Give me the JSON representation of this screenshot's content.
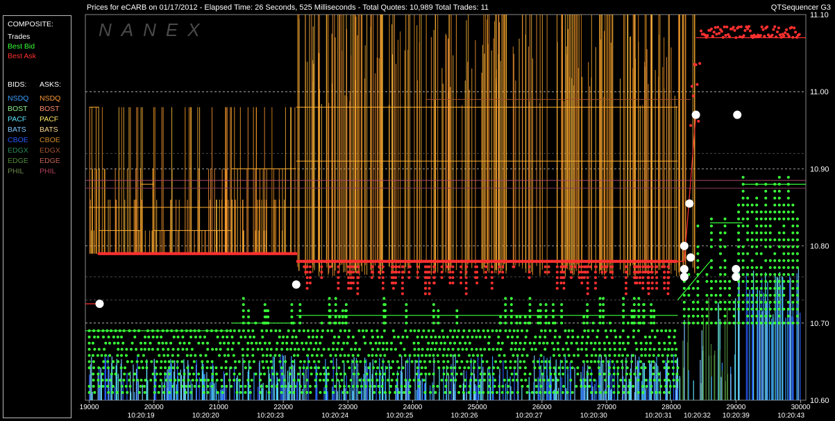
{
  "header": {
    "title": "Prices for  eCARB  on  01/17/2012  -  Elapsed Time: 26 Seconds, 525 Milliseconds  -  Total Quotes: 10,989  Total Trades: 11",
    "right_label": "QTSequencer G3"
  },
  "watermark": "NANEX",
  "legend": {
    "composite_title": "COMPOSITE:",
    "composite_items": [
      {
        "label": "Trades",
        "color": "#ffffff"
      },
      {
        "label": "Best Bid",
        "color": "#39ff39"
      },
      {
        "label": "Best Ask",
        "color": "#ff3030"
      }
    ],
    "bids_title": "BIDS:",
    "asks_title": "ASKS:",
    "exchanges": [
      {
        "bid": "NSDQ",
        "ask": "NSDQ",
        "bid_color": "#3aa0ff",
        "ask_color": "#ff9a3a"
      },
      {
        "bid": "BOST",
        "ask": "BOST",
        "bid_color": "#8ff08f",
        "ask_color": "#ff8c6a"
      },
      {
        "bid": "PACF",
        "ask": "PACF",
        "bid_color": "#5ee6ff",
        "ask_color": "#ffe866"
      },
      {
        "bid": "BATS",
        "ask": "BATS",
        "bid_color": "#7ec8ff",
        "ask_color": "#ffd890"
      },
      {
        "bid": "CBOE",
        "ask": "CBOE",
        "bid_color": "#2a5cff",
        "ask_color": "#d08a2a"
      },
      {
        "bid": "EDGX",
        "ask": "EDGX",
        "bid_color": "#2a8a5a",
        "ask_color": "#a0522d"
      },
      {
        "bid": "EDGE",
        "ask": "EDGE",
        "bid_color": "#4f8a3a",
        "ask_color": "#c06050"
      },
      {
        "bid": "PHIL",
        "ask": "PHIL",
        "bid_color": "#6a8a4a",
        "ask_color": "#b0405a"
      }
    ]
  },
  "chart_data": {
    "type": "scatter",
    "title": "Prices for eCARB on 01/17/2012",
    "xlim": [
      18940,
      30080
    ],
    "ylim": [
      10.6,
      11.1
    ],
    "grid": true,
    "x_ticks": [
      19000,
      20000,
      21000,
      22000,
      23000,
      24000,
      25000,
      26000,
      27000,
      28000,
      29000,
      30000
    ],
    "y_ticks": [
      10.6,
      10.7,
      10.8,
      10.9,
      11.0,
      11.1
    ],
    "y_tick_labels": [
      "10.60",
      "10.70",
      "10.80",
      "10.90",
      "11.00",
      "11.10"
    ],
    "time_labels": [
      {
        "x": 19800,
        "label": "10:20:19"
      },
      {
        "x": 20800,
        "label": "10:20:20"
      },
      {
        "x": 21800,
        "label": "10:20:23"
      },
      {
        "x": 22800,
        "label": "10:20:24"
      },
      {
        "x": 23800,
        "label": "10:20:25"
      },
      {
        "x": 24800,
        "label": "10:20:26"
      },
      {
        "x": 25800,
        "label": "10:20:27"
      },
      {
        "x": 26800,
        "label": "10:20:30"
      },
      {
        "x": 27800,
        "label": "10:20:31"
      },
      {
        "x": 28400,
        "label": "10:20:32"
      },
      {
        "x": 29000,
        "label": "10:20:39"
      },
      {
        "x": 29850,
        "label": "10:20:43"
      }
    ],
    "series": [
      {
        "name": "Trades",
        "color": "#ffffff",
        "points": [
          [
            19160,
            10.725
          ],
          [
            22200,
            10.75
          ],
          [
            28200,
            10.8
          ],
          [
            28300,
            10.785
          ],
          [
            28200,
            10.77
          ],
          [
            28280,
            10.855
          ],
          [
            28200,
            10.76
          ],
          [
            28380,
            10.97
          ],
          [
            29000,
            10.77
          ],
          [
            29000,
            10.76
          ],
          [
            29020,
            10.97
          ]
        ]
      },
      {
        "name": "Best Ask",
        "color": "#ff3030",
        "segments": [
          [
            18940,
            10.725,
            19150,
            10.725
          ],
          [
            19150,
            10.79,
            22200,
            10.79
          ],
          [
            22200,
            10.78,
            28200,
            10.78
          ],
          [
            28200,
            10.78,
            28380,
            10.97
          ],
          [
            28380,
            11.07,
            29000,
            11.07
          ],
          [
            29000,
            11.07,
            30080,
            11.07
          ]
        ]
      },
      {
        "name": "Best Bid",
        "color": "#39ff39",
        "segments": [
          [
            18940,
            10.69,
            21200,
            10.69
          ],
          [
            21200,
            10.7,
            22200,
            10.7
          ],
          [
            22200,
            10.71,
            28100,
            10.71
          ],
          [
            28100,
            10.73,
            28600,
            10.78
          ],
          [
            28600,
            10.83,
            29100,
            10.83
          ],
          [
            29100,
            10.88,
            30080,
            10.88
          ]
        ]
      }
    ]
  }
}
